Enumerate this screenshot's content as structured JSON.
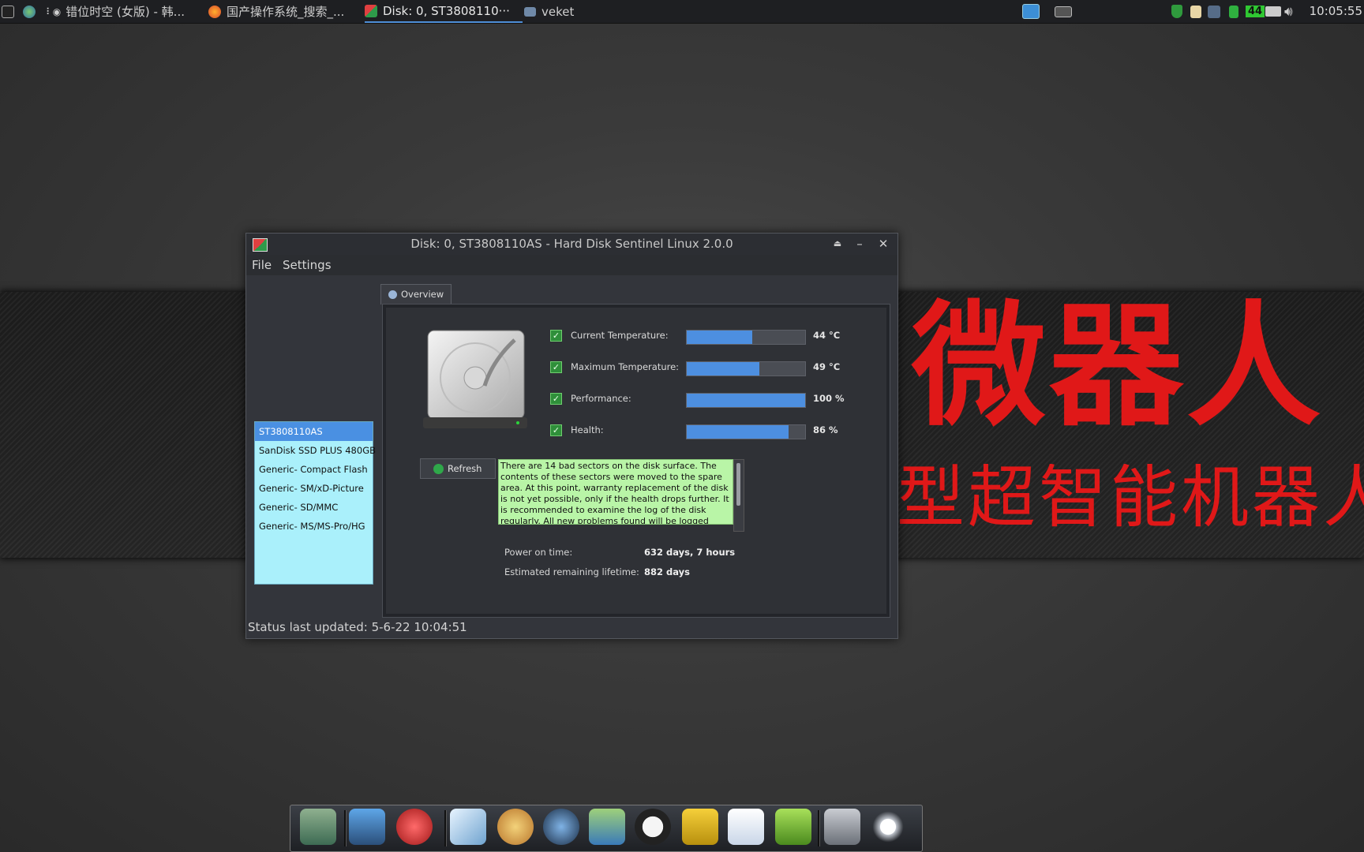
{
  "taskbar": {
    "tasks": [
      {
        "label": "错位时空 (女版) - 韩..."
      },
      {
        "label": "国产操作系统_搜索_..."
      },
      {
        "label": "Disk: 0, ST3808110···"
      },
      {
        "label": "veket"
      }
    ],
    "tray_badge": "44",
    "clock": "10:05:55"
  },
  "wallpaper": {
    "big_text": "微器人",
    "small_text": "型超智能机器人"
  },
  "window": {
    "title": "Disk: 0, ST3808110AS - Hard Disk Sentinel Linux 2.0.0",
    "menu": [
      "File",
      "Settings"
    ],
    "disks": [
      "ST3808110AS",
      "SanDisk SSD PLUS 480GB",
      "Generic- Compact Flash",
      "Generic- SM/xD-Picture",
      "Generic- SD/MMC",
      "Generic- MS/MS-Pro/HG"
    ],
    "selected_disk_index": 0,
    "tab_label": "Overview",
    "metrics": [
      {
        "label": "Current Temperature:",
        "value": "44 °C",
        "level": 0.55
      },
      {
        "label": "Maximum Temperature:",
        "value": "49 °C",
        "level": 0.61
      },
      {
        "label": "Performance:",
        "value": "100 %",
        "level": 1.0
      },
      {
        "label": "Health:",
        "value": "86 %",
        "level": 0.86
      }
    ],
    "refresh_label": "Refresh",
    "note": "There are 14 bad sectors on the disk surface. The contents of these sectors were moved to the spare area. At this point, warranty replacement of the disk is not yet possible, only if the health drops further. It is recommended to examine the log of the disk regularly. All new problems found will be logged there.",
    "power_on_label": "Power on time:",
    "power_on_value": "632 days, 7 hours",
    "lifetime_label": "Estimated remaining lifetime:",
    "lifetime_value": "882 days",
    "status": "Status last updated: 5-6-22 10:04:51"
  },
  "colors": {
    "accent": "#4d8fe0",
    "wallpaper_text": "#e01818",
    "disk_list_bg": "#aaf0fb",
    "note_bg": "#b9f5a7"
  }
}
